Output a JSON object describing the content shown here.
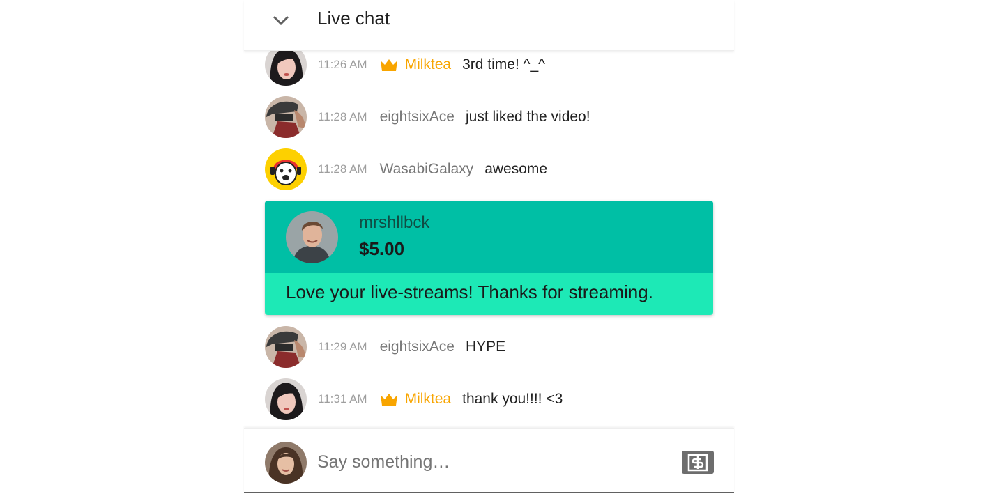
{
  "header": {
    "title": "Live chat",
    "collapse_icon": "chevron-down-icon"
  },
  "messages": [
    {
      "time": "11:26 AM",
      "author": "Milktea",
      "member": true,
      "text": "3rd time! ^_^",
      "avatar": "woman-dark-hair"
    },
    {
      "time": "11:28 AM",
      "author": "eightsixAce",
      "member": false,
      "text": "just liked the video!",
      "avatar": "helmet-rider"
    },
    {
      "time": "11:28 AM",
      "author": "WasabiGalaxy",
      "member": false,
      "text": "awesome",
      "avatar": "cartoon-character"
    }
  ],
  "superchat": {
    "author": "mrshllbck",
    "amount": "$5.00",
    "message": "Love your live-streams! Thanks for streaming.",
    "header_color": "#00bfa5",
    "body_color": "#1de9b6"
  },
  "messages_after": [
    {
      "time": "11:29 AM",
      "author": "eightsixAce",
      "member": false,
      "text": "HYPE",
      "avatar": "helmet-rider"
    },
    {
      "time": "11:31 AM",
      "author": "Milktea",
      "member": true,
      "text": "thank you!!!! <3",
      "avatar": "woman-dark-hair"
    }
  ],
  "input": {
    "placeholder": "Say something…",
    "donate_icon": "dollar-icon"
  },
  "colors": {
    "member": "#f8a500",
    "timestamp": "#9e9e9e",
    "author": "#757575"
  }
}
